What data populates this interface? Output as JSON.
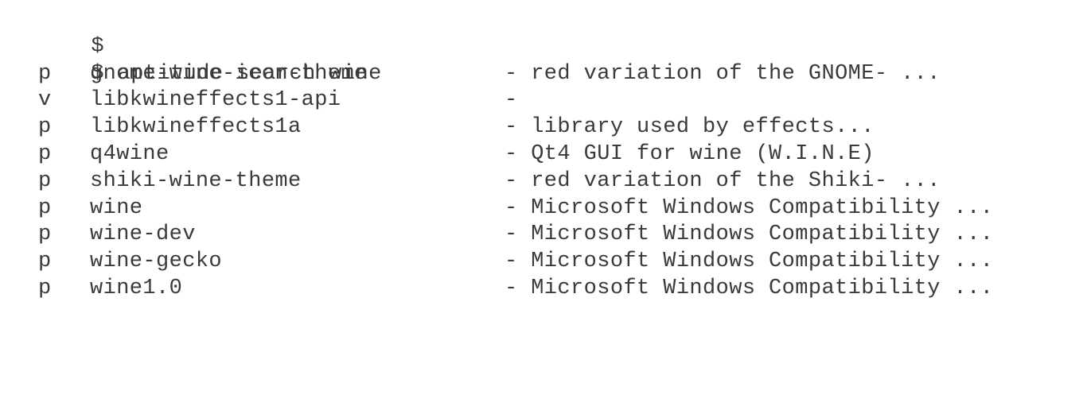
{
  "terminal": {
    "prompt_lines": [
      {
        "prompt": "$",
        "command": ""
      },
      {
        "prompt": "$",
        "command": "aptitude search wine"
      }
    ],
    "results": [
      {
        "status": "p",
        "package": "gnome-wine-icon-theme",
        "description": "- red variation of the GNOME- ..."
      },
      {
        "status": "v",
        "package": "libkwineffects1-api",
        "description": "-"
      },
      {
        "status": "p",
        "package": "libkwineffects1a",
        "description": "- library used by effects..."
      },
      {
        "status": "p",
        "package": "q4wine",
        "description": "- Qt4 GUI for wine (W.I.N.E)"
      },
      {
        "status": "p",
        "package": "shiki-wine-theme",
        "description": "- red variation of the Shiki- ..."
      },
      {
        "status": "p",
        "package": "wine",
        "description": "- Microsoft Windows Compatibility ..."
      },
      {
        "status": "p",
        "package": "wine-dev",
        "description": "- Microsoft Windows Compatibility ..."
      },
      {
        "status": "p",
        "package": "wine-gecko",
        "description": "- Microsoft Windows Compatibility ..."
      },
      {
        "status": "p",
        "package": "wine1.0",
        "description": "- Microsoft Windows Compatibility ..."
      }
    ]
  }
}
